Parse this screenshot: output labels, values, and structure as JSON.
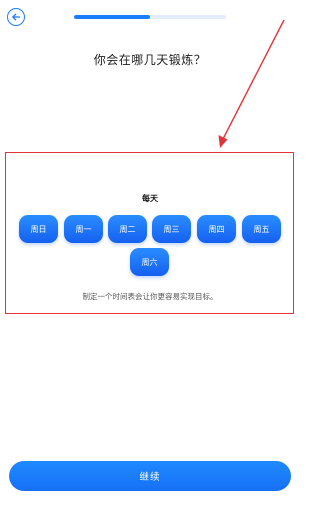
{
  "header": {
    "back_icon": "arrow-left-icon",
    "progress": 0.5
  },
  "question": "你会在哪几天锻炼？",
  "schedule": {
    "frequency_label": "每天",
    "days": [
      "周日",
      "周一",
      "周二",
      "周三",
      "周四",
      "周五",
      "周六"
    ],
    "hint": "制定一个时间表会让你更容易实现目标。"
  },
  "continue_label": "继续",
  "colors": {
    "accent": "#1a7cff",
    "annotation": "#e0343a"
  }
}
